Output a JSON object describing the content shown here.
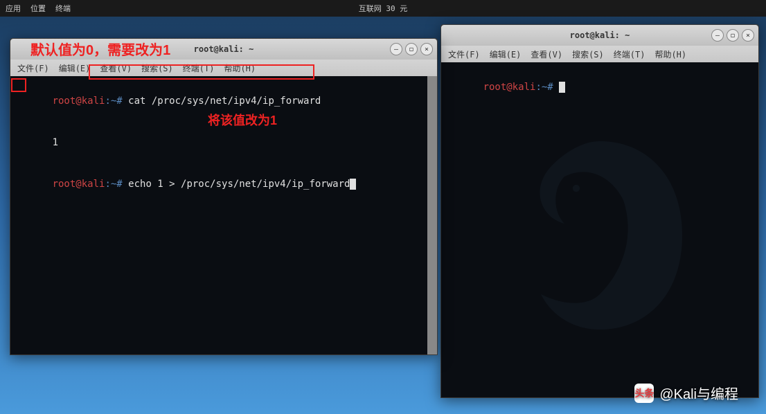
{
  "panel": {
    "left_items": [
      "应用",
      "位置",
      "终端"
    ],
    "center": "互联网 30 元"
  },
  "left_window": {
    "title": "root@kali: ~",
    "menu": [
      "文件(F)",
      "编辑(E)",
      "查看(V)",
      "搜索(S)",
      "终端(T)",
      "帮助(H)"
    ],
    "lines": [
      {
        "prompt_user": "root@kali",
        "prompt_path": ":~#",
        "cmd": " cat /proc/sys/net/ipv4/ip_forward"
      },
      {
        "output": "1"
      },
      {
        "prompt_user": "root@kali",
        "prompt_path": ":~#",
        "cmd": " echo 1 > /proc/sys/net/ipv4/ip_forward",
        "cursor": true
      }
    ]
  },
  "right_window": {
    "title": "root@kali: ~",
    "menu": [
      "文件(F)",
      "编辑(E)",
      "查看(V)",
      "搜索(S)",
      "终端(T)",
      "帮助(H)"
    ],
    "prompt_user": "root@kali",
    "prompt_path": ":~#",
    "cmd": " "
  },
  "annotations": {
    "top": "默认值为0，需要改为1",
    "mid": "将该值改为1"
  },
  "watermark": {
    "label": "头条",
    "handle": "@Kali与编程"
  },
  "window_buttons": {
    "minimize": "–",
    "maximize": "◻",
    "close": "×"
  }
}
